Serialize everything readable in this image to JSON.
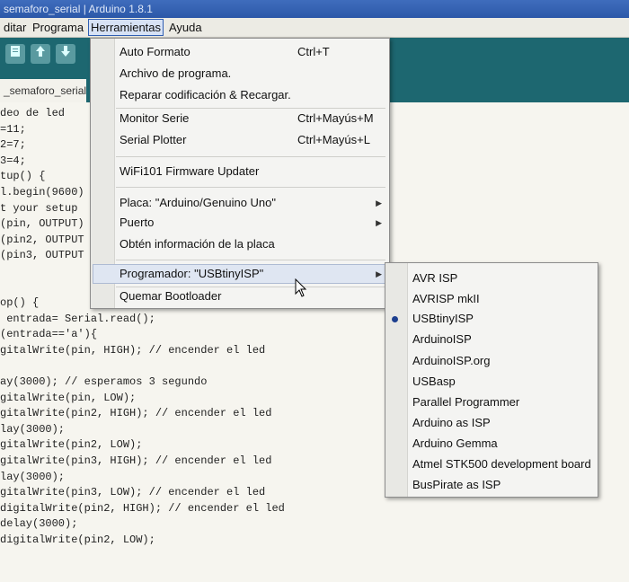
{
  "window": {
    "title": "semaforo_serial | Arduino 1.8.1"
  },
  "menubar": {
    "items": [
      "ditar",
      "Programa",
      "Herramientas",
      "Ayuda"
    ]
  },
  "toolbar": {
    "buttons": [
      "new-icon",
      "open-icon",
      "save-icon"
    ]
  },
  "tab": {
    "label": "_semaforo_serial"
  },
  "tools_menu": {
    "items": [
      {
        "label": "Auto Formato",
        "shortcut": "Ctrl+T"
      },
      {
        "label": "Archivo de programa.",
        "shortcut": ""
      },
      {
        "label": "Reparar codificación & Recargar.",
        "shortcut": ""
      },
      {
        "label": "Monitor Serie",
        "shortcut": "Ctrl+Mayús+M"
      },
      {
        "label": "Serial Plotter",
        "shortcut": "Ctrl+Mayús+L"
      },
      {
        "label": "WiFi101 Firmware Updater",
        "shortcut": ""
      },
      {
        "label": "Placa: \"Arduino/Genuino Uno\"",
        "shortcut": "",
        "submenu": true
      },
      {
        "label": "Puerto",
        "shortcut": "",
        "submenu": true
      },
      {
        "label": "Obtén información de la placa",
        "shortcut": ""
      },
      {
        "label": "Programador: \"USBtinyISP\"",
        "shortcut": "",
        "submenu": true,
        "highlighted": true
      },
      {
        "label": "Quemar Bootloader",
        "shortcut": ""
      }
    ]
  },
  "programmer_submenu": {
    "selected": "USBtinyISP",
    "items": [
      "AVR ISP",
      "AVRISP mkII",
      "USBtinyISP",
      "ArduinoISP",
      "ArduinoISP.org",
      "USBasp",
      "Parallel Programmer",
      "Arduino as ISP",
      "Arduino Gemma",
      "Atmel STK500 development board",
      "BusPirate as ISP"
    ]
  },
  "code_lines": [
    "deo de led",
    "=11;",
    "2=7;",
    "3=4;",
    "tup() {",
    "l.begin(9600)",
    "t your setup",
    "(pin, OUTPUT)",
    "(pin2, OUTPUT",
    "(pin3, OUTPUT",
    "",
    "",
    "op() {",
    " entrada= Serial.read();",
    "(entrada=='a'){",
    "gitalWrite(pin, HIGH); // encender el led",
    "",
    "ay(3000); // esperamos 3 segundo",
    "gitalWrite(pin, LOW);",
    "gitalWrite(pin2, HIGH); // encender el led",
    "lay(3000);",
    "gitalWrite(pin2, LOW);",
    "gitalWrite(pin3, HIGH); // encender el led",
    "lay(3000);",
    "gitalWrite(pin3, LOW); // encender el led",
    "digitalWrite(pin2, HIGH); // encender el led",
    "delay(3000);",
    "digitalWrite(pin2, LOW);"
  ],
  "colors": {
    "toolbar": "#1d6770",
    "menu_highlight": "#dfe6f2",
    "radio": "#1d3f8f"
  }
}
